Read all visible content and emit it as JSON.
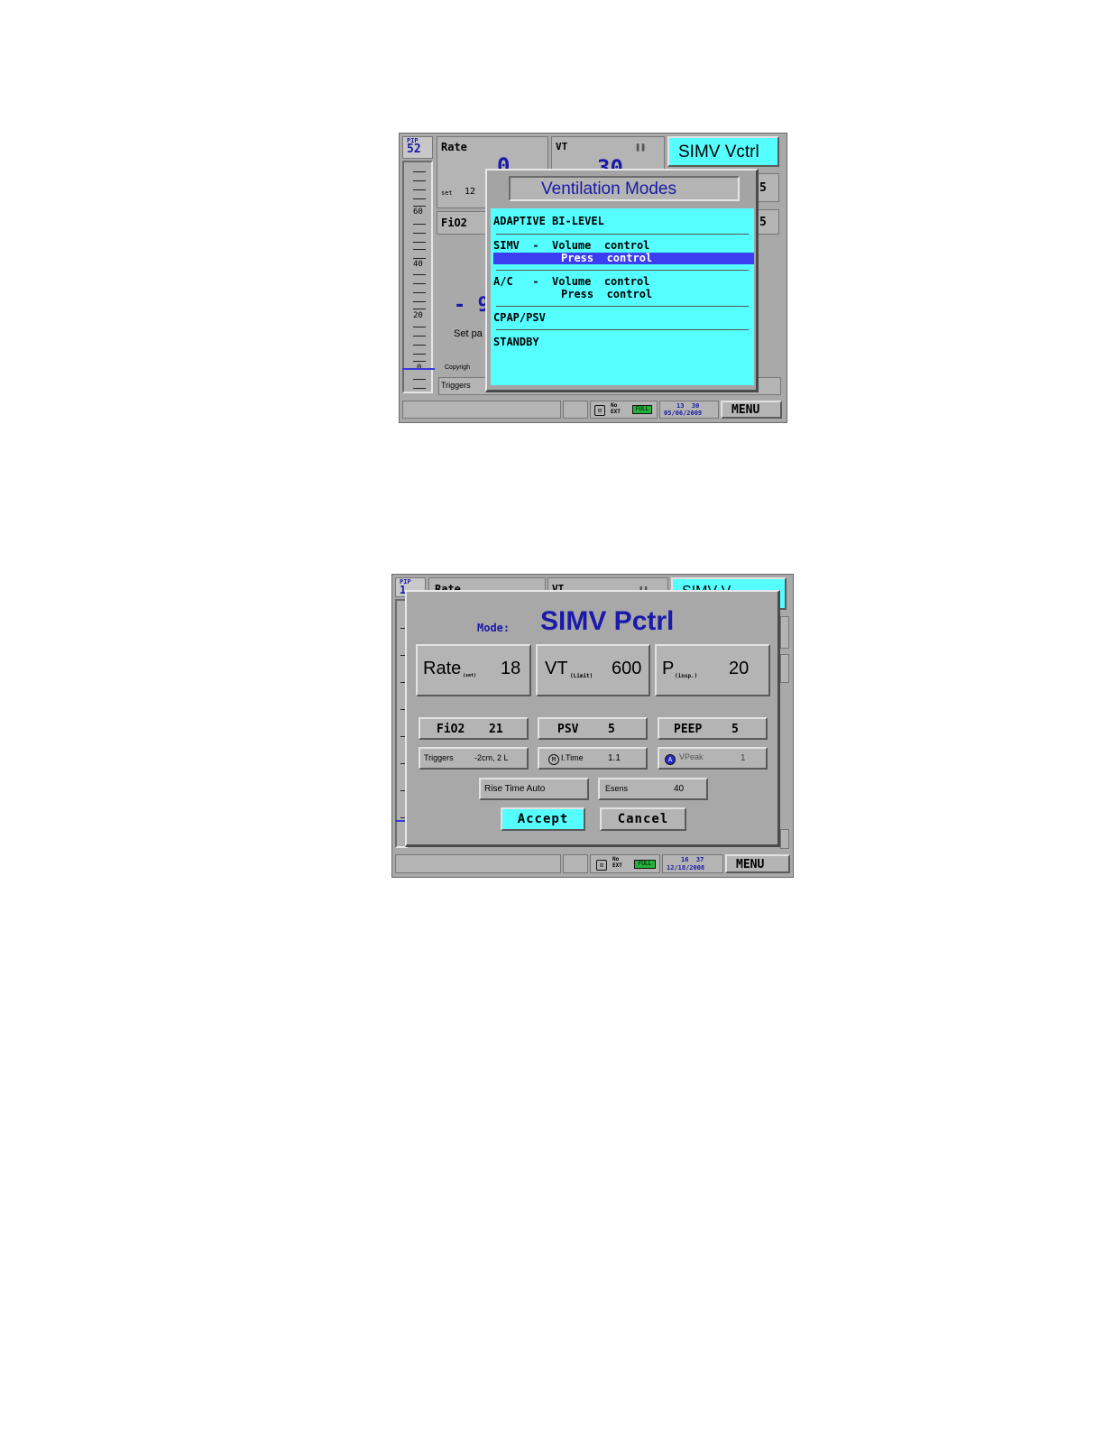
{
  "screen1": {
    "pip_label": "PIP",
    "pip_value": "52",
    "rate_label": "Rate",
    "rate_value": "0",
    "set_label": "set",
    "set_value": "12",
    "vt_label": "VT",
    "vt_value": "30",
    "pause_icon": "pause-icon",
    "mode_badge": "SIMV Vctrl",
    "fio2_label": "FiO2",
    "right_value_1": "5",
    "right_value_2": "5",
    "big_dash": "- 9",
    "set_pa_label": "Set pa",
    "copyright_label": "Copyrigh",
    "triggers_label": "Triggers",
    "gauge_labels": [
      "60",
      "40",
      "20",
      "0"
    ],
    "modes_dialog": {
      "title": "Ventilation Modes",
      "items": [
        {
          "line1": "ADAPTIVE BI-LEVEL"
        },
        {
          "line1": "SIMV  -  Volume  control",
          "line2": "Press  control",
          "selected_line2": true
        },
        {
          "line1": "A/C   -  Volume  control",
          "line2": "Press  control"
        },
        {
          "line1": "CPAP/PSV"
        },
        {
          "line1": "STANDBY"
        }
      ]
    },
    "status": {
      "no_ext": "No\nEXT",
      "battery": "FULL",
      "time": "13  30",
      "date": "05/06/2009",
      "menu": "MENU"
    }
  },
  "screen2": {
    "pip_label": "PIP",
    "pip_value": "1",
    "rate_partial": "Rate",
    "vt_partial": "VT",
    "mode_partial": "SIMV V...",
    "dialog": {
      "mode_label": "Mode:",
      "mode_value": "SIMV Pctrl",
      "rate_label": "Rate",
      "rate_sub": "(set)",
      "rate_value": "18",
      "vt_label": "VT",
      "vt_sub": "(Limit)",
      "vt_value": "600",
      "p_label": "P",
      "p_sub": "(insp.)",
      "p_value": "20",
      "fio2_label": "FiO2",
      "fio2_value": "21",
      "psv_label": "PSV",
      "psv_value": "5",
      "peep_label": "PEEP",
      "peep_value": "5",
      "triggers_label": "Triggers",
      "triggers_value": "-2cm, 2 L",
      "itime_prefix": "M",
      "itime_label": "I.Time",
      "itime_value": "1.1",
      "vpeak_prefix": "A",
      "vpeak_label": "VPeak",
      "vpeak_value": "1",
      "rise_time": "Rise Time Auto",
      "esens_label": "Esens",
      "esens_value": "40",
      "accept": "Accept",
      "cancel": "Cancel"
    },
    "status": {
      "no_ext": "No\nEXT",
      "battery": "FULL",
      "time": "16  37",
      "date": "12/18/2008",
      "menu": "MENU"
    }
  }
}
